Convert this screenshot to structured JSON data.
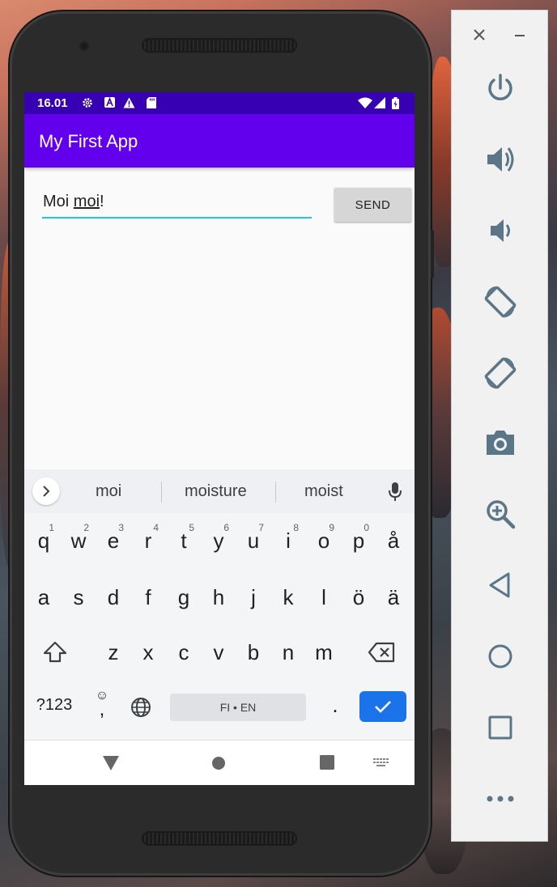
{
  "status_bar": {
    "time": "16.01",
    "icons": [
      "settings-icon",
      "a-badge-icon",
      "warning-icon",
      "sd-card-icon",
      "wifi-icon",
      "signal-icon",
      "battery-icon"
    ]
  },
  "app_bar": {
    "title": "My First App"
  },
  "input": {
    "text_before": "Moi ",
    "text_underlined": "moi",
    "text_after": "!"
  },
  "send_button": {
    "label": "SEND"
  },
  "suggestions": [
    "moi",
    "moisture",
    "moist"
  ],
  "keyboard": {
    "row1": [
      {
        "char": "q",
        "num": "1"
      },
      {
        "char": "w",
        "num": "2"
      },
      {
        "char": "e",
        "num": "3"
      },
      {
        "char": "r",
        "num": "4"
      },
      {
        "char": "t",
        "num": "5"
      },
      {
        "char": "y",
        "num": "6"
      },
      {
        "char": "u",
        "num": "7"
      },
      {
        "char": "i",
        "num": "8"
      },
      {
        "char": "o",
        "num": "9"
      },
      {
        "char": "p",
        "num": "0"
      },
      {
        "char": "å",
        "num": ""
      }
    ],
    "row2": [
      "a",
      "s",
      "d",
      "f",
      "g",
      "h",
      "j",
      "k",
      "l",
      "ö",
      "ä"
    ],
    "row3": [
      "z",
      "x",
      "c",
      "v",
      "b",
      "n",
      "m"
    ],
    "symbols_label": "?123",
    "emoji_label": "☺",
    "comma_label": ",",
    "space_label": "FI • EN",
    "period_label": "."
  },
  "colors": {
    "status_bar": "#3700b3",
    "app_bar": "#6200ee",
    "input_underline": "#1ecbd0",
    "enter_key": "#1a73e8",
    "panel_icon": "#5b7687"
  },
  "emulator_panel": {
    "controls": [
      "close-icon",
      "minimize-icon",
      "power-icon",
      "volume-up-icon",
      "volume-down-icon",
      "rotate-left-icon",
      "rotate-right-icon",
      "camera-icon",
      "zoom-icon",
      "back-icon",
      "home-icon",
      "overview-icon",
      "more-icon"
    ]
  }
}
